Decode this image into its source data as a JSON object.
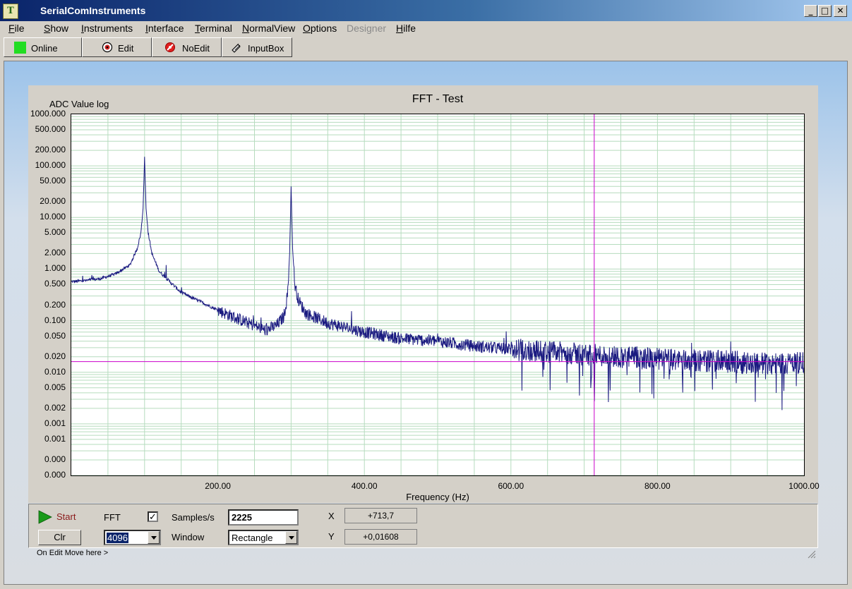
{
  "window": {
    "title": "SerialComInstruments",
    "icon": "tz-app-icon",
    "controls": [
      "minimize-icon",
      "maximize-icon",
      "close-icon"
    ]
  },
  "menu": [
    {
      "label": "File",
      "underline": "F"
    },
    {
      "label": "Show",
      "underline": "S"
    },
    {
      "label": "Instruments",
      "underline": "I"
    },
    {
      "label": "Interface",
      "underline": "I"
    },
    {
      "label": "Terminal",
      "underline": "T"
    },
    {
      "label": "NormalView",
      "underline": "N"
    },
    {
      "label": "Options",
      "underline": "O"
    },
    {
      "label": "Designer",
      "disabled": true
    },
    {
      "label": "Hilfe",
      "underline": "H"
    }
  ],
  "toolbar": {
    "online_label": "Online",
    "online_color": "#22dd22",
    "edit_label": "Edit",
    "noedit_label": "NoEdit",
    "inputbox_label": "InputBox"
  },
  "chart_data": {
    "type": "line",
    "title": "FFT - Test",
    "ylabel": "ADC Value log",
    "xlabel": "Frequency (Hz)",
    "x_scale": "linear",
    "y_scale": "log",
    "xlim": [
      0,
      1000
    ],
    "ylim": [
      0.0001,
      1000
    ],
    "x_ticks": [
      "200.00",
      "400.00",
      "600.00",
      "800.00",
      "1000.00"
    ],
    "y_ticks": [
      {
        "label": "1000.000",
        "value": 1000
      },
      {
        "label": "500.000",
        "value": 500
      },
      {
        "label": "200.000",
        "value": 200
      },
      {
        "label": "100.000",
        "value": 100
      },
      {
        "label": "50.000",
        "value": 50
      },
      {
        "label": "20.000",
        "value": 20
      },
      {
        "label": "10.000",
        "value": 10
      },
      {
        "label": "5.000",
        "value": 5
      },
      {
        "label": "2.000",
        "value": 2
      },
      {
        "label": "1.000",
        "value": 1
      },
      {
        "label": "0.500",
        "value": 0.5
      },
      {
        "label": "0.200",
        "value": 0.2
      },
      {
        "label": "0.100",
        "value": 0.1
      },
      {
        "label": "0.050",
        "value": 0.05
      },
      {
        "label": "0.020",
        "value": 0.02
      },
      {
        "label": "0.010",
        "value": 0.01
      },
      {
        "label": "0.005",
        "value": 0.005
      },
      {
        "label": "0.002",
        "value": 0.002
      },
      {
        "label": "0.001",
        "value": 0.001
      },
      {
        "label": "0.001",
        "value": 0.0005
      },
      {
        "label": "0.000",
        "value": 0.0002
      },
      {
        "label": "0.000",
        "value": 0.0001
      }
    ],
    "grid": true,
    "series": [
      {
        "color": "#1a1a80",
        "x": [
          0,
          20,
          40,
          60,
          80,
          90,
          95,
          98,
          100,
          102,
          105,
          110,
          120,
          150,
          180,
          200,
          220,
          250,
          265,
          280,
          290,
          295,
          298,
          300,
          302,
          305,
          310,
          320,
          350,
          400,
          450,
          500,
          550,
          600,
          650,
          700,
          750,
          800,
          850,
          900,
          950,
          1000
        ],
        "y": [
          0.57,
          0.6,
          0.65,
          0.8,
          1.2,
          2.5,
          5.0,
          15,
          150,
          15,
          5,
          2,
          0.9,
          0.35,
          0.22,
          0.16,
          0.12,
          0.08,
          0.065,
          0.08,
          0.12,
          0.3,
          2.0,
          40,
          2.5,
          0.5,
          0.25,
          0.14,
          0.09,
          0.06,
          0.045,
          0.04,
          0.032,
          0.028,
          0.025,
          0.022,
          0.02,
          0.018,
          0.017,
          0.016,
          0.015,
          0.015
        ],
        "noise": "high-frequency noise floor increasing above 600 Hz"
      }
    ],
    "cursor": {
      "x": 713.7,
      "y": 0.01608,
      "color": "#cc00cc"
    }
  },
  "controls": {
    "start_label": "Start",
    "clr_label": "Clr",
    "fft_label": "FFT",
    "fft_checked": true,
    "fft_size": "4096",
    "samples_label": "Samples/s",
    "samples_value": "2225",
    "window_label": "Window",
    "window_value": "Rectangle",
    "x_label": "X",
    "x_value": "+713,7",
    "y_label": "Y",
    "y_value": "+0,01608"
  },
  "status": {
    "text": "On Edit Move here >"
  }
}
